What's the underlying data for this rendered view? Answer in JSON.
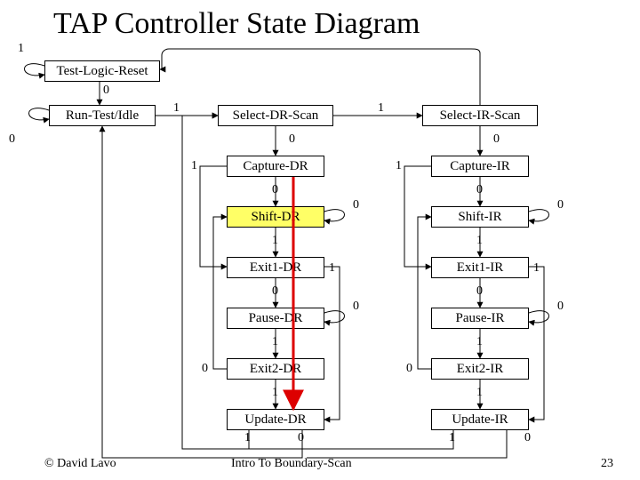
{
  "title": "TAP Controller State Diagram",
  "states": {
    "tlr": "Test-Logic-Reset",
    "rti": "Run-Test/Idle",
    "sdr": "Select-DR-Scan",
    "cdr": "Capture-DR",
    "shdr": "Shift-DR",
    "e1dr": "Exit1-DR",
    "pdr": "Pause-DR",
    "e2dr": "Exit2-DR",
    "udr": "Update-DR",
    "sir": "Select-IR-Scan",
    "cir": "Capture-IR",
    "shir": "Shift-IR",
    "e1ir": "Exit1-IR",
    "pir": "Pause-IR",
    "e2ir": "Exit2-IR",
    "uir": "Update-IR"
  },
  "labels": {
    "zero": "0",
    "one": "1"
  },
  "footer": {
    "left": "© David Lavo",
    "center": "Intro To Boundary-Scan",
    "right": "23"
  },
  "active_state": "shdr",
  "chart_data": {
    "type": "state_diagram",
    "title": "TAP Controller State Diagram",
    "initial_state": "Test-Logic-Reset",
    "highlighted_state": "Shift-DR",
    "highlighted_transition": {
      "from": "Capture-DR",
      "to": "Update-DR",
      "color": "red"
    },
    "states": [
      "Test-Logic-Reset",
      "Run-Test/Idle",
      "Select-DR-Scan",
      "Capture-DR",
      "Shift-DR",
      "Exit1-DR",
      "Pause-DR",
      "Exit2-DR",
      "Update-DR",
      "Select-IR-Scan",
      "Capture-IR",
      "Shift-IR",
      "Exit1-IR",
      "Pause-IR",
      "Exit2-IR",
      "Update-IR"
    ],
    "transitions": [
      {
        "from": "Test-Logic-Reset",
        "input": "1",
        "to": "Test-Logic-Reset"
      },
      {
        "from": "Test-Logic-Reset",
        "input": "0",
        "to": "Run-Test/Idle"
      },
      {
        "from": "Run-Test/Idle",
        "input": "0",
        "to": "Run-Test/Idle"
      },
      {
        "from": "Run-Test/Idle",
        "input": "1",
        "to": "Select-DR-Scan"
      },
      {
        "from": "Select-DR-Scan",
        "input": "1",
        "to": "Select-IR-Scan"
      },
      {
        "from": "Select-DR-Scan",
        "input": "0",
        "to": "Capture-DR"
      },
      {
        "from": "Capture-DR",
        "input": "0",
        "to": "Shift-DR"
      },
      {
        "from": "Capture-DR",
        "input": "1",
        "to": "Exit1-DR"
      },
      {
        "from": "Shift-DR",
        "input": "0",
        "to": "Shift-DR"
      },
      {
        "from": "Shift-DR",
        "input": "1",
        "to": "Exit1-DR"
      },
      {
        "from": "Exit1-DR",
        "input": "0",
        "to": "Pause-DR"
      },
      {
        "from": "Exit1-DR",
        "input": "1",
        "to": "Update-DR"
      },
      {
        "from": "Pause-DR",
        "input": "0",
        "to": "Pause-DR"
      },
      {
        "from": "Pause-DR",
        "input": "1",
        "to": "Exit2-DR"
      },
      {
        "from": "Exit2-DR",
        "input": "0",
        "to": "Shift-DR"
      },
      {
        "from": "Exit2-DR",
        "input": "1",
        "to": "Update-DR"
      },
      {
        "from": "Update-DR",
        "input": "1",
        "to": "Select-DR-Scan"
      },
      {
        "from": "Update-DR",
        "input": "0",
        "to": "Run-Test/Idle"
      },
      {
        "from": "Select-IR-Scan",
        "input": "1",
        "to": "Test-Logic-Reset"
      },
      {
        "from": "Select-IR-Scan",
        "input": "0",
        "to": "Capture-IR"
      },
      {
        "from": "Capture-IR",
        "input": "0",
        "to": "Shift-IR"
      },
      {
        "from": "Capture-IR",
        "input": "1",
        "to": "Exit1-IR"
      },
      {
        "from": "Shift-IR",
        "input": "0",
        "to": "Shift-IR"
      },
      {
        "from": "Shift-IR",
        "input": "1",
        "to": "Exit1-IR"
      },
      {
        "from": "Exit1-IR",
        "input": "0",
        "to": "Pause-IR"
      },
      {
        "from": "Exit1-IR",
        "input": "1",
        "to": "Update-IR"
      },
      {
        "from": "Pause-IR",
        "input": "0",
        "to": "Pause-IR"
      },
      {
        "from": "Pause-IR",
        "input": "1",
        "to": "Exit2-IR"
      },
      {
        "from": "Exit2-IR",
        "input": "0",
        "to": "Shift-IR"
      },
      {
        "from": "Exit2-IR",
        "input": "1",
        "to": "Update-IR"
      },
      {
        "from": "Update-IR",
        "input": "1",
        "to": "Select-DR-Scan"
      },
      {
        "from": "Update-IR",
        "input": "0",
        "to": "Run-Test/Idle"
      }
    ]
  }
}
